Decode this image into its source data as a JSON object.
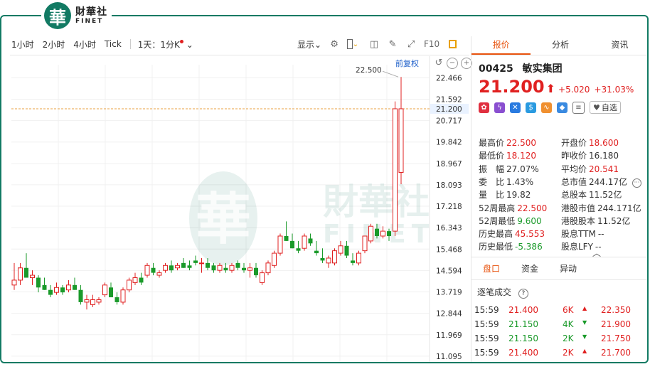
{
  "brand": {
    "seal": "華",
    "cn": "財華社",
    "en": "FINET"
  },
  "toolbar": {
    "periods": [
      "1小时",
      "2小时",
      "4小时",
      "Tick"
    ],
    "kline": "1天：1分K",
    "display": "显示",
    "fq_label": "前复权",
    "fiq": "F10"
  },
  "chart_data": {
    "type": "candlestick",
    "y_ticks": [
      "22.466",
      "21.592",
      "20.717",
      "19.842",
      "18.967",
      "18.093",
      "17.218",
      "16.343",
      "15.468",
      "14.594",
      "13.719",
      "12.844",
      "11.969",
      "11.095"
    ],
    "ylim": [
      10.8,
      23.0
    ],
    "prev_close_line": 21.2,
    "current_label": "21.200",
    "high_label": "22.500",
    "watermark": {
      "cn": "財華社",
      "en": "FINET",
      "seal": "華"
    },
    "candles": [
      [
        14.0,
        14.9,
        13.8,
        14.2
      ],
      [
        14.2,
        14.9,
        14.0,
        14.7
      ],
      [
        14.7,
        15.3,
        14.6,
        14.3
      ],
      [
        14.3,
        14.6,
        14.0,
        14.4
      ],
      [
        14.3,
        14.4,
        13.7,
        13.9
      ],
      [
        14.0,
        14.3,
        13.8,
        13.8
      ],
      [
        13.8,
        14.0,
        13.5,
        13.6
      ],
      [
        13.7,
        14.1,
        13.6,
        13.9
      ],
      [
        13.9,
        14.0,
        13.6,
        13.7
      ],
      [
        13.8,
        14.2,
        13.7,
        14.0
      ],
      [
        14.0,
        14.3,
        13.8,
        13.8
      ],
      [
        13.8,
        14.0,
        13.2,
        13.3
      ],
      [
        13.3,
        13.6,
        13.0,
        13.4
      ],
      [
        13.2,
        13.6,
        13.1,
        13.4
      ],
      [
        13.3,
        13.5,
        13.2,
        13.4
      ],
      [
        13.6,
        14.1,
        13.5,
        14.0
      ],
      [
        13.9,
        14.1,
        13.5,
        13.5
      ],
      [
        13.5,
        13.7,
        13.2,
        13.3
      ],
      [
        13.3,
        13.9,
        13.2,
        13.8
      ],
      [
        13.8,
        14.3,
        13.7,
        14.2
      ],
      [
        14.1,
        14.5,
        14.0,
        14.3
      ],
      [
        14.3,
        14.5,
        14.0,
        14.1
      ],
      [
        14.4,
        14.9,
        14.3,
        14.8
      ],
      [
        14.7,
        14.9,
        14.4,
        14.5
      ],
      [
        14.4,
        14.6,
        14.3,
        14.5
      ],
      [
        14.6,
        14.9,
        14.5,
        14.8
      ],
      [
        14.8,
        15.0,
        14.5,
        14.6
      ],
      [
        14.7,
        14.9,
        14.6,
        14.8
      ],
      [
        14.9,
        15.1,
        14.7,
        14.7
      ],
      [
        14.8,
        15.0,
        14.6,
        14.7
      ],
      [
        15.0,
        15.2,
        14.8,
        14.9
      ],
      [
        14.9,
        15.1,
        14.5,
        14.9
      ],
      [
        14.9,
        15.1,
        14.6,
        14.7
      ],
      [
        14.8,
        14.9,
        14.5,
        14.6
      ],
      [
        14.6,
        14.9,
        14.5,
        14.8
      ],
      [
        14.7,
        14.9,
        14.5,
        14.6
      ],
      [
        14.6,
        14.9,
        14.5,
        14.8
      ],
      [
        14.9,
        15.0,
        14.6,
        14.7
      ],
      [
        14.7,
        14.9,
        14.5,
        14.6
      ],
      [
        14.6,
        14.9,
        14.3,
        14.7
      ],
      [
        14.7,
        14.9,
        14.3,
        14.4
      ],
      [
        14.1,
        14.6,
        14.0,
        14.5
      ],
      [
        14.5,
        15.0,
        14.4,
        14.9
      ],
      [
        14.8,
        15.4,
        14.7,
        15.3
      ],
      [
        15.3,
        16.1,
        15.2,
        16.0
      ],
      [
        16.0,
        16.6,
        15.8,
        15.8
      ],
      [
        15.8,
        16.1,
        15.5,
        15.5
      ],
      [
        15.5,
        15.8,
        15.3,
        15.4
      ],
      [
        15.5,
        16.1,
        15.4,
        16.0
      ],
      [
        15.9,
        16.1,
        15.6,
        15.7
      ],
      [
        15.4,
        15.8,
        15.2,
        15.3
      ],
      [
        15.1,
        15.5,
        14.9,
        15.0
      ],
      [
        14.9,
        15.2,
        14.7,
        15.1
      ],
      [
        14.9,
        15.5,
        14.8,
        15.4
      ],
      [
        15.3,
        15.8,
        15.2,
        15.6
      ],
      [
        15.6,
        15.8,
        15.1,
        15.2
      ],
      [
        15.0,
        15.3,
        14.8,
        14.9
      ],
      [
        14.9,
        15.4,
        14.8,
        15.3
      ],
      [
        15.4,
        16.0,
        15.3,
        16.0
      ],
      [
        15.8,
        16.5,
        15.7,
        16.4
      ],
      [
        16.3,
        16.5,
        15.9,
        16.0
      ],
      [
        16.0,
        16.4,
        15.9,
        16.2
      ],
      [
        16.2,
        16.3,
        15.8,
        16.0
      ],
      [
        16.2,
        21.5,
        16.0,
        21.2
      ],
      [
        18.6,
        22.5,
        18.12,
        21.2
      ]
    ]
  },
  "quote": {
    "tabs": [
      "报价",
      "分析",
      "资讯"
    ],
    "code": "00425",
    "name": "敏实集团",
    "price": "21.200",
    "change": "+5.020",
    "pct": "+31.03%",
    "watch": "自选",
    "left": [
      {
        "k": "最高价",
        "v": "22.500",
        "c": "red"
      },
      {
        "k": "最低价",
        "v": "18.120",
        "c": "red"
      },
      {
        "k": "振　幅",
        "v": "27.07%",
        "c": ""
      },
      {
        "k": "委　比",
        "v": "1.43%",
        "c": ""
      },
      {
        "k": "量　比",
        "v": "19.82",
        "c": ""
      },
      {
        "k": "52周最高",
        "v": "22.500",
        "c": "red"
      },
      {
        "k": "52周最低",
        "v": "9.600",
        "c": "green"
      },
      {
        "k": "历史最高",
        "v": "45.553",
        "c": "red"
      },
      {
        "k": "历史最低",
        "v": "-5.386",
        "c": "green"
      }
    ],
    "right": [
      {
        "k": "开盘价",
        "v": "18.600",
        "c": "red"
      },
      {
        "k": "昨收价",
        "v": "16.180",
        "c": ""
      },
      {
        "k": "平均价",
        "v": "20.541",
        "c": "red"
      },
      {
        "k": "总市值",
        "v": "244.17亿",
        "c": ""
      },
      {
        "k": "总股本",
        "v": "11.52亿",
        "c": ""
      },
      {
        "k": "港股市值",
        "v": "244.171亿",
        "c": ""
      },
      {
        "k": "港股股本",
        "v": "11.52亿",
        "c": ""
      },
      {
        "k": "股息TTM",
        "v": "--",
        "c": ""
      },
      {
        "k": "股息LFY",
        "v": "--",
        "c": ""
      }
    ],
    "sections": [
      "盘口",
      "资金",
      "异动"
    ],
    "ticks_title": "逐笔成交",
    "ticks": [
      {
        "t": "15:59",
        "p": "21.400",
        "vol": "6K",
        "dir": "up",
        "ref": "22.350"
      },
      {
        "t": "15:59",
        "p": "21.150",
        "vol": "4K",
        "dir": "down",
        "ref": "21.900"
      },
      {
        "t": "15:59",
        "p": "21.150",
        "vol": "2K",
        "dir": "down",
        "ref": "21.750"
      },
      {
        "t": "15:59",
        "p": "21.400",
        "vol": "2K",
        "dir": "up",
        "ref": "21.700"
      }
    ]
  },
  "colors": {
    "brand": "#127a63",
    "up": "#e02020",
    "down": "#1a9a2a",
    "accent": "#e8530e"
  }
}
